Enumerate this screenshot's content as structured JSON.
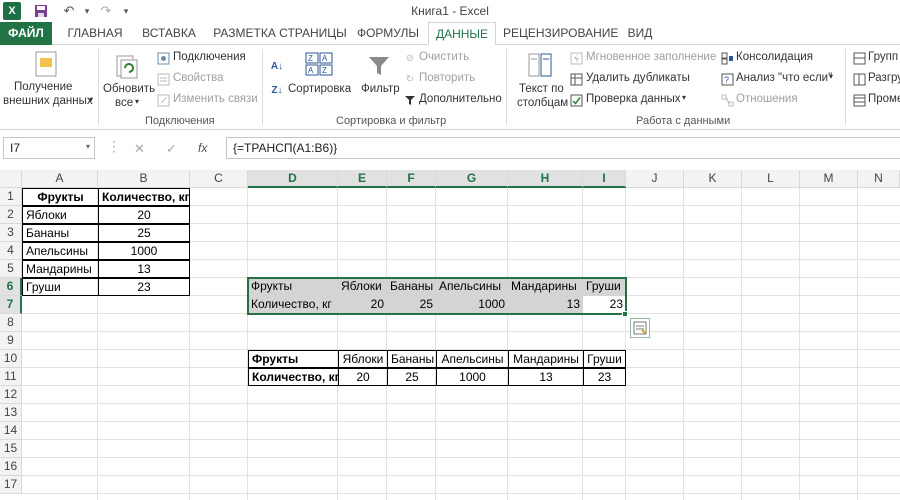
{
  "window": {
    "title": "Книга1 - Excel",
    "app_icon": "X"
  },
  "tabs": [
    {
      "label": "ФАЙЛ"
    },
    {
      "label": "ГЛАВНАЯ"
    },
    {
      "label": "ВСТАВКА"
    },
    {
      "label": "РАЗМЕТКА СТРАНИЦЫ"
    },
    {
      "label": "ФОРМУЛЫ"
    },
    {
      "label": "ДАННЫЕ"
    },
    {
      "label": "РЕЦЕНЗИРОВАНИЕ"
    },
    {
      "label": "ВИД"
    }
  ],
  "active_tab": "ДАННЫЕ",
  "ribbon": {
    "get_external_1": "Получение",
    "get_external_2": "внешних данных",
    "refresh_1": "Обновить",
    "refresh_2": "все",
    "connections": "Подключения",
    "properties": "Свойства",
    "edit_links": "Изменить связи",
    "group_connections": "Подключения",
    "sort": "Сортировка",
    "filter": "Фильтр",
    "clear": "Очистить",
    "reapply": "Повторить",
    "advanced": "Дополнительно",
    "group_sort_filter": "Сортировка и фильтр",
    "text_to_cols_1": "Текст по",
    "text_to_cols_2": "столбцам",
    "flash_fill": "Мгновенное заполнение",
    "remove_dup": "Удалить дубликаты",
    "data_validation": "Проверка данных",
    "consolidate": "Консолидация",
    "what_if": "Анализ \"что если\"",
    "relationships": "Отношения",
    "group_data_tools": "Работа с данными",
    "group": "Групп",
    "ungroup": "Разгру",
    "subtotal": "Проме"
  },
  "formula_bar": {
    "name_box": "I7",
    "cancel": "✕",
    "enter": "✓",
    "fx": "fx",
    "formula": "{=ТРАНСП(A1:B6)}"
  },
  "columns": [
    "A",
    "B",
    "C",
    "D",
    "E",
    "F",
    "G",
    "H",
    "I",
    "J",
    "K",
    "L",
    "M",
    "N"
  ],
  "rows": [
    "1",
    "2",
    "3",
    "4",
    "5",
    "6",
    "7",
    "8",
    "9",
    "10",
    "11",
    "12",
    "13",
    "14",
    "15",
    "16",
    "17"
  ],
  "source_table": {
    "header": [
      "Фрукты",
      "Количество, кг"
    ],
    "rows": [
      [
        "Яблоки",
        "20"
      ],
      [
        "Бананы",
        "25"
      ],
      [
        "Апельсины",
        "1000"
      ],
      [
        "Мандарины",
        "13"
      ],
      [
        "Груши",
        "23"
      ]
    ]
  },
  "transposed_array": {
    "row1": [
      "Фрукты",
      "Яблоки",
      "Бананы",
      "Апельсины",
      "Мандарины",
      "Груши"
    ],
    "row2": [
      "Количество, кг",
      "20",
      "25",
      "1000",
      "13",
      "23"
    ]
  },
  "transposed_table": {
    "row1": [
      "Фрукты",
      "Яблоки",
      "Бананы",
      "Апельсины",
      "Мандарины",
      "Груши"
    ],
    "row2": [
      "Количество, кг",
      "20",
      "25",
      "1000",
      "13",
      "23"
    ]
  },
  "colors": {
    "excel_green": "#217346",
    "selection_shade": "#d4d4d4"
  }
}
